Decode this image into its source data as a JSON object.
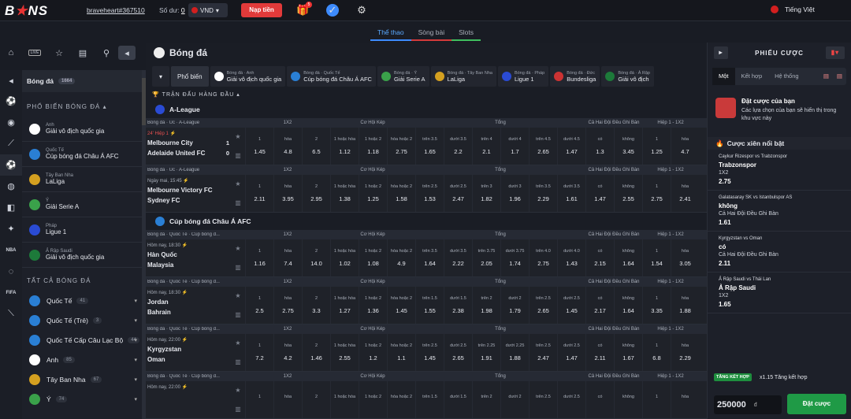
{
  "topbar": {
    "logo_b": "B",
    "logo_rest": "NS",
    "username": "braveheart#367510",
    "balance_label": "Số dư:",
    "balance_value": "0",
    "currency": "VND",
    "deposit_label": "Nạp tiền",
    "gift_badge": "5",
    "language": "Tiếng Việt"
  },
  "tabs": [
    "Thể thao",
    "Sòng bài",
    "Slots"
  ],
  "rail_icons": [
    "home-icon",
    "live-icon",
    "star-icon",
    "document-icon",
    "search-icon",
    "collapse-icon"
  ],
  "sport_icons": [
    "soccer-ball-icon",
    "basketball-icon",
    "tennis-icon",
    "volleyball-icon",
    "esports-icon",
    "nba-icon",
    "fifa-icon",
    "cricket-icon"
  ],
  "left": {
    "title": "Bóng đá",
    "title_count": "1664",
    "popular_heading": "PHỔ BIẾN BÓNG ĐÁ",
    "popular": [
      {
        "a": "Anh",
        "b": "Giải vô địch quốc gia",
        "color": "#ffffff"
      },
      {
        "a": "Quốc Tế",
        "b": "Cúp bóng đá Châu Á AFC",
        "color": "#2a7fd4"
      },
      {
        "a": "Tây Ban Nha",
        "b": "LaLiga",
        "color": "#d4a020"
      },
      {
        "a": "Ý",
        "b": "Giải Serie A",
        "color": "#3aa14a"
      },
      {
        "a": "Pháp",
        "b": "Ligue 1",
        "color": "#2a4bd4"
      },
      {
        "a": "Ả Rập Saudi",
        "b": "Giải vô địch quốc gia",
        "color": "#1d7a3a"
      }
    ],
    "all_heading": "TẤT CẢ BÓNG ĐÁ",
    "all": [
      {
        "name": "Quốc Tế",
        "count": "41",
        "color": "#2a7fd4"
      },
      {
        "name": "Quốc Tế (Trẻ)",
        "count": "3",
        "color": "#2a7fd4"
      },
      {
        "name": "Quốc Tế Cấp Câu Lạc Bộ",
        "count": "44",
        "color": "#2a7fd4"
      },
      {
        "name": "Anh",
        "count": "85",
        "color": "#ffffff"
      },
      {
        "name": "Tây Ban Nha",
        "count": "67",
        "color": "#d4a020"
      },
      {
        "name": "Ý",
        "count": "74",
        "color": "#3aa14a"
      }
    ]
  },
  "main": {
    "title": "Bóng đá",
    "chip_popular": "Phổ biến",
    "chips": [
      {
        "a": "Bóng đá · Anh",
        "b": "Giải vô địch quốc gia",
        "color": "#ffffff"
      },
      {
        "a": "Bóng đá · Quốc Tế",
        "b": "Cúp bóng đá Châu Á AFC",
        "color": "#2a7fd4"
      },
      {
        "a": "Bóng đá · Ý",
        "b": "Giải Serie A",
        "color": "#3aa14a"
      },
      {
        "a": "Bóng đá · Tây Ban Nha",
        "b": "LaLiga",
        "color": "#d4a020"
      },
      {
        "a": "Bóng đá · Pháp",
        "b": "Ligue 1",
        "color": "#2a4bd4"
      },
      {
        "a": "Bóng đá · Đức",
        "b": "Bundesliga",
        "color": "#c33"
      },
      {
        "a": "Bóng đá · Ả Rập",
        "b": "Giải vô địch",
        "color": "#1d7a3a"
      }
    ],
    "section_title": "TRẬN ĐẤU HÀNG ĐẦU",
    "groups": "see-matches"
  },
  "matches": [
    {
      "league_header": "A-League",
      "breadcrumb": "Bóng đá · Úc · A-League",
      "time": "24' Hiệp 1",
      "live": true,
      "home": "Melbourne City",
      "away": "Adelaide United FC",
      "score_home": "1",
      "score_away": "0",
      "cols": [
        "1X2",
        "",
        "",
        "Cơ Hội Kép",
        "",
        "",
        "Tổng",
        "",
        "",
        "",
        "",
        "",
        "Cả Hai Đội Đều Ghi Bàn",
        "",
        "Hiệp 1 - 1X2",
        ""
      ],
      "labels": [
        "1",
        "hòa",
        "2",
        "1 hoặc hòa",
        "1 hoặc 2",
        "hòa hoặc 2",
        "trên 3.5",
        "dưới 3.5",
        "trên 4",
        "dưới 4",
        "trên 4.5",
        "dưới 4.5",
        "có",
        "không",
        "1",
        "hòa"
      ],
      "values": [
        "1.45",
        "4.8",
        "6.5",
        "1.12",
        "1.18",
        "2.75",
        "1.65",
        "2.2",
        "2.1",
        "1.7",
        "2.65",
        "1.47",
        "1.3",
        "3.45",
        "1.25",
        "4.7"
      ]
    },
    {
      "league_header": "",
      "breadcrumb": "Bóng đá · Úc · A-League",
      "time": "Ngày mai, 15:45",
      "live": false,
      "home": "Melbourne Victory FC",
      "away": "Sydney FC",
      "score_home": "",
      "score_away": "",
      "labels": [
        "1",
        "hòa",
        "2",
        "1 hoặc hòa",
        "1 hoặc 2",
        "hòa hoặc 2",
        "trên 2.5",
        "dưới 2.5",
        "trên 3",
        "dưới 3",
        "trên 3.5",
        "dưới 3.5",
        "có",
        "không",
        "1",
        "hòa"
      ],
      "values": [
        "2.11",
        "3.95",
        "2.95",
        "1.38",
        "1.25",
        "1.58",
        "1.53",
        "2.47",
        "1.82",
        "1.96",
        "2.29",
        "1.61",
        "1.47",
        "2.55",
        "2.75",
        "2.41"
      ]
    },
    {
      "league_header": "Cúp bóng đá Châu Á AFC",
      "breadcrumb": "Bóng đá · Quốc Tế · Cúp bóng đ...",
      "time": "Hôm nay, 18:30",
      "live": false,
      "home": "Hàn Quốc",
      "away": "Malaysia",
      "score_home": "",
      "score_away": "",
      "labels": [
        "1",
        "hòa",
        "2",
        "1 hoặc hòa",
        "1 hoặc 2",
        "hòa hoặc 2",
        "trên 3.5",
        "dưới 3.5",
        "trên 3.75",
        "dưới 3.75",
        "trên 4.0",
        "dưới 4.0",
        "có",
        "không",
        "1",
        "hòa"
      ],
      "values": [
        "1.16",
        "7.4",
        "14.0",
        "1.02",
        "1.08",
        "4.9",
        "1.64",
        "2.22",
        "2.05",
        "1.74",
        "2.75",
        "1.43",
        "2.15",
        "1.64",
        "1.54",
        "3.05"
      ]
    },
    {
      "league_header": "",
      "breadcrumb": "Bóng đá · Quốc Tế · Cúp bóng đ...",
      "time": "Hôm nay, 18:30",
      "live": false,
      "home": "Jordan",
      "away": "Bahrain",
      "score_home": "",
      "score_away": "",
      "labels": [
        "1",
        "hòa",
        "2",
        "1 hoặc hòa",
        "1 hoặc 2",
        "hòa hoặc 2",
        "trên 1.5",
        "dưới 1.5",
        "trên 2",
        "dưới 2",
        "trên 2.5",
        "dưới 2.5",
        "có",
        "không",
        "1",
        "hòa"
      ],
      "values": [
        "2.5",
        "2.75",
        "3.3",
        "1.27",
        "1.36",
        "1.45",
        "1.55",
        "2.38",
        "1.98",
        "1.79",
        "2.65",
        "1.45",
        "2.17",
        "1.64",
        "3.35",
        "1.88"
      ]
    },
    {
      "league_header": "",
      "breadcrumb": "Bóng đá · Quốc Tế · Cúp bóng đ...",
      "time": "Hôm nay, 22:00",
      "live": false,
      "home": "Kyrgyzstan",
      "away": "Oman",
      "score_home": "",
      "score_away": "",
      "labels": [
        "1",
        "hòa",
        "2",
        "1 hoặc hòa",
        "1 hoặc 2",
        "hòa hoặc 2",
        "trên 2.5",
        "dưới 2.5",
        "trên 2.25",
        "dưới 2.25",
        "trên 2.5",
        "dưới 2.5",
        "có",
        "không",
        "1",
        "hòa"
      ],
      "values": [
        "7.2",
        "4.2",
        "1.46",
        "2.55",
        "1.2",
        "1.1",
        "1.45",
        "2.65",
        "1.91",
        "1.88",
        "2.47",
        "1.47",
        "2.11",
        "1.67",
        "6.8",
        "2.29"
      ]
    },
    {
      "league_header": "",
      "breadcrumb": "Bóng đá · Quốc Tế · Cúp bóng đ...",
      "time": "Hôm nay, 22:00",
      "live": false,
      "home": "",
      "away": "",
      "score_home": "",
      "score_away": "",
      "labels": [
        "1",
        "hòa",
        "2",
        "1 hoặc hòa",
        "1 hoặc 2",
        "hòa hoặc 2",
        "trên 1.5",
        "dưới 1.5",
        "trên 2",
        "dưới 2",
        "trên 2.5",
        "dưới 2.5",
        "có",
        "không",
        "1",
        "hòa"
      ],
      "values": [
        "",
        "",
        "",
        "",
        "",
        "",
        "",
        "",
        "",
        "",
        "",
        "",
        "",
        "",
        "",
        ""
      ]
    }
  ],
  "column_groups": [
    "1X2",
    "Cơ Hội Kép",
    "Tổng",
    "Cả Hai Đội Đều Ghi Bàn",
    "Hiệp 1 - 1X2"
  ],
  "right": {
    "title": "PHIẾU CƯỢC",
    "tabs": [
      "Một",
      "Kết hợp",
      "Hệ thống"
    ],
    "empty_title": "Đặt cược của bạn",
    "empty_sub": "Các lựa chọn của bạn sẽ hiển thị trong khu vực này",
    "hot_title": "Cược xiên nổi bật",
    "picks": [
      {
        "match": "Caykur Rizespor vs Trabzonspor",
        "pick": "Trabzonspor",
        "market": "1X2",
        "odd": "2.75"
      },
      {
        "match": "Galatasaray SK vs Istanbulspor AS",
        "pick": "không",
        "market": "Cả Hai Đội Đều Ghi Bàn",
        "odd": "1.61"
      },
      {
        "match": "Kyrgyzstan vs Oman",
        "pick": "có",
        "market": "Cả Hai Đội Đều Ghi Bàn",
        "odd": "2.11"
      },
      {
        "match": "Ả Rập Saudi vs Thái Lan",
        "pick": "Ả Rập Saudi",
        "market": "1X2",
        "odd": "1.65"
      }
    ],
    "combo_badge": "TĂNG KẾT HỢP",
    "combo_text": "x1.15 Tăng kết hợp",
    "stake": "250000",
    "stake_unit": "đ",
    "bet_button": "Đặt cược"
  }
}
